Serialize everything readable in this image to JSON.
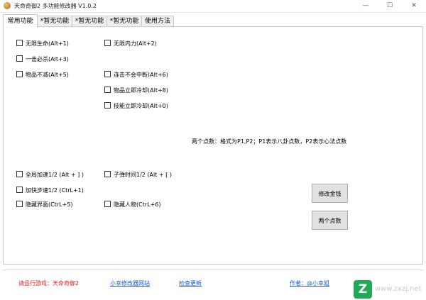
{
  "window": {
    "title": "天命奇御2 多功能修改器  V1.0.2",
    "controls": [
      "—",
      "☐",
      "✕"
    ]
  },
  "tabs": [
    {
      "label": "常用功能",
      "active": true
    },
    {
      "label": "*暂无功能",
      "active": false
    },
    {
      "label": "*暂无功能",
      "active": false
    },
    {
      "label": "*暂无功能",
      "active": false
    },
    {
      "label": "使用方法",
      "active": false
    }
  ],
  "checkboxes": {
    "c1": "无限生命(Alt+1)",
    "c2": "无限内力(Alt+2)",
    "c3": "一击必杀(Alt+3)",
    "c5": "物品不减(Alt+5)",
    "c6": "连击不会中断(Alt+6)",
    "c8": "物品立即冷却(Alt+8)",
    "c0": "技能立即冷却(Alt+0)",
    "speed_all": "全局加速1/2 (Alt + ] )",
    "bullet_time": "子弹时间1/2 (Alt + [ )",
    "speed_walk": "加快步速1/2 (CtrL+1)",
    "hide_ui": "隐藏界面(CtrL+5)",
    "hide_char": "隐藏人物(CtrL+6)"
  },
  "note": "两个点数：格式为P1,P2；P1表示八卦点数，P2表示心法点数",
  "buttons": {
    "money": "修改金钱",
    "points": "两个点数"
  },
  "footer": {
    "status": "请运行游戏：天命奇御2",
    "site": "小幸修改器网站",
    "update": "检查更新",
    "author": "作者：@小幸姐"
  },
  "watermark": {
    "icon": "Z",
    "text": "www.zxzj.net"
  }
}
